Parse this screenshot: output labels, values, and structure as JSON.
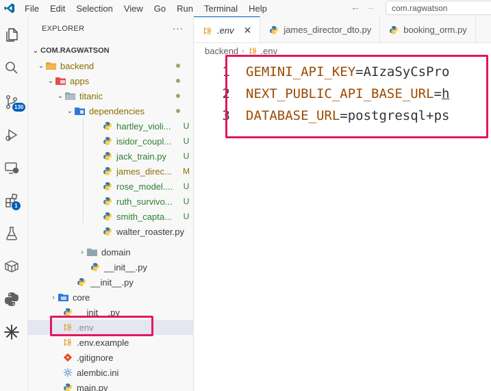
{
  "menu": {
    "items": [
      "File",
      "Edit",
      "Selection",
      "View",
      "Go",
      "Run",
      "Terminal",
      "Help"
    ]
  },
  "nav": {
    "back": "←",
    "forward": "→"
  },
  "command_center": {
    "text": "com.ragwatson"
  },
  "activity_bar": {
    "icons": [
      "explorer-icon",
      "search-icon",
      "source-control-icon",
      "run-debug-icon",
      "remote-explorer-icon",
      "extensions-icon",
      "testing-icon",
      "containers-icon",
      "python-icon",
      "ai-assistant-icon"
    ],
    "scm_badge": "130",
    "extensions_badge": "1"
  },
  "explorer": {
    "title": "EXPLORER",
    "more": "···",
    "root": "COM.RAGWATSON",
    "rows": [
      {
        "label": "backend",
        "type": "folder",
        "decoration": "dot"
      },
      {
        "label": "apps",
        "type": "folder",
        "decoration": "dot"
      },
      {
        "label": "titanic",
        "type": "folder",
        "decoration": "dot"
      },
      {
        "label": "dependencies",
        "type": "folder",
        "decoration": "dot"
      },
      {
        "label": "hartley_violi...",
        "type": "python",
        "decoration": "U"
      },
      {
        "label": "isidor_coupl...",
        "type": "python",
        "decoration": "U"
      },
      {
        "label": "jack_train.py",
        "type": "python",
        "decoration": "U"
      },
      {
        "label": "james_direc...",
        "type": "python",
        "decoration": "M"
      },
      {
        "label": "rose_model....",
        "type": "python",
        "decoration": "U"
      },
      {
        "label": "ruth_survivo...",
        "type": "python",
        "decoration": "U"
      },
      {
        "label": "smith_capta...",
        "type": "python",
        "decoration": "U"
      },
      {
        "label": "walter_roaster.py",
        "type": "python",
        "decoration": ""
      },
      {
        "label": "domain",
        "type": "folder",
        "decoration": ""
      },
      {
        "label": "__init__.py",
        "type": "python",
        "decoration": ""
      },
      {
        "label": "__init__.py",
        "type": "python",
        "decoration": ""
      },
      {
        "label": "core",
        "type": "folder",
        "decoration": ""
      },
      {
        "label": "__init__.py",
        "type": "python",
        "decoration": ""
      },
      {
        "label": ".env",
        "type": "env",
        "decoration": ""
      },
      {
        "label": ".env.example",
        "type": "env",
        "decoration": ""
      },
      {
        "label": ".gitignore",
        "type": "git",
        "decoration": ""
      },
      {
        "label": "alembic.ini",
        "type": "settings",
        "decoration": ""
      },
      {
        "label": "main.py",
        "type": "python",
        "decoration": ""
      }
    ]
  },
  "tabs": [
    {
      "title": ".env",
      "icon": "env-icon",
      "active": true,
      "close": "✕"
    },
    {
      "title": "james_director_dto.py",
      "icon": "python-icon",
      "active": false
    },
    {
      "title": "booking_orm.py",
      "icon": "python-icon",
      "active": false
    }
  ],
  "breadcrumb": {
    "folder": "backend",
    "sep": "›",
    "file": ".env"
  },
  "editor": {
    "lines": [
      {
        "n": "1",
        "key": "GEMINI_API_KEY",
        "eq": "=",
        "value": "AIzaSyCsPro"
      },
      {
        "n": "2",
        "key": "NEXT_PUBLIC_API_BASE_URL",
        "eq": "=",
        "value": "h"
      },
      {
        "n": "3",
        "key": "DATABASE_URL",
        "eq": "=",
        "value": "postgresql+ps"
      }
    ]
  },
  "colors": {
    "highlight": "#e2175d",
    "accent": "#005fb8",
    "untracked": "#2e7d32",
    "modified": "#8a6d00"
  }
}
